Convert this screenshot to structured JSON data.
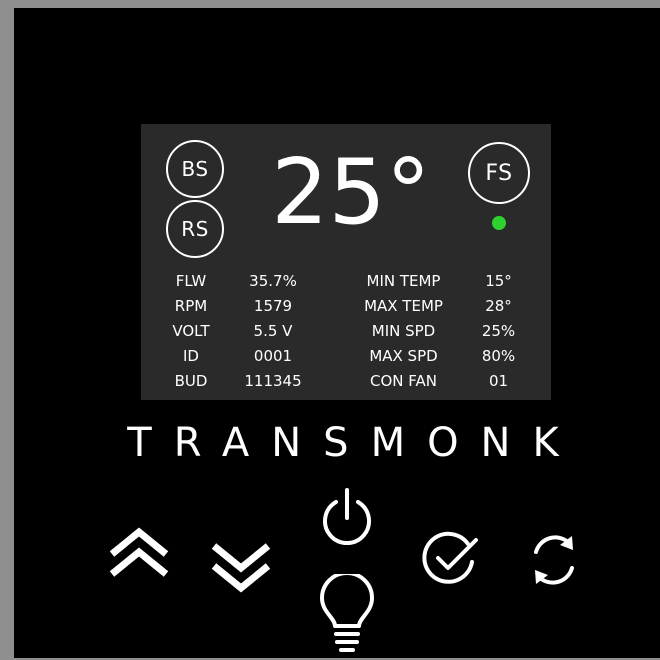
{
  "screen": {
    "temperature": "25°",
    "buttons": {
      "bs": "BS",
      "rs": "RS",
      "fs": "FS"
    },
    "indicator_color": "#2ed12e",
    "left_stats": {
      "labels": [
        "FLW",
        "RPM",
        "VOLT",
        "ID",
        "BUD"
      ],
      "values": [
        "35.7%",
        "1579",
        "5.5 V",
        "0001",
        "111345"
      ]
    },
    "right_stats": {
      "labels": [
        "MIN TEMP",
        "MAX TEMP",
        "MIN SPD",
        "MAX SPD",
        "CON FAN"
      ],
      "values": [
        "15°",
        "28°",
        "25%",
        "80%",
        "01"
      ]
    }
  },
  "brand": "TRANSMONK",
  "controls": [
    {
      "name": "up",
      "icon": "double-chevron-up-icon"
    },
    {
      "name": "down",
      "icon": "double-chevron-down-icon"
    },
    {
      "name": "power",
      "icon": "power-icon"
    },
    {
      "name": "light",
      "icon": "light-bulb-icon"
    },
    {
      "name": "confirm",
      "icon": "check-circle-icon"
    },
    {
      "name": "refresh",
      "icon": "refresh-icon"
    }
  ]
}
